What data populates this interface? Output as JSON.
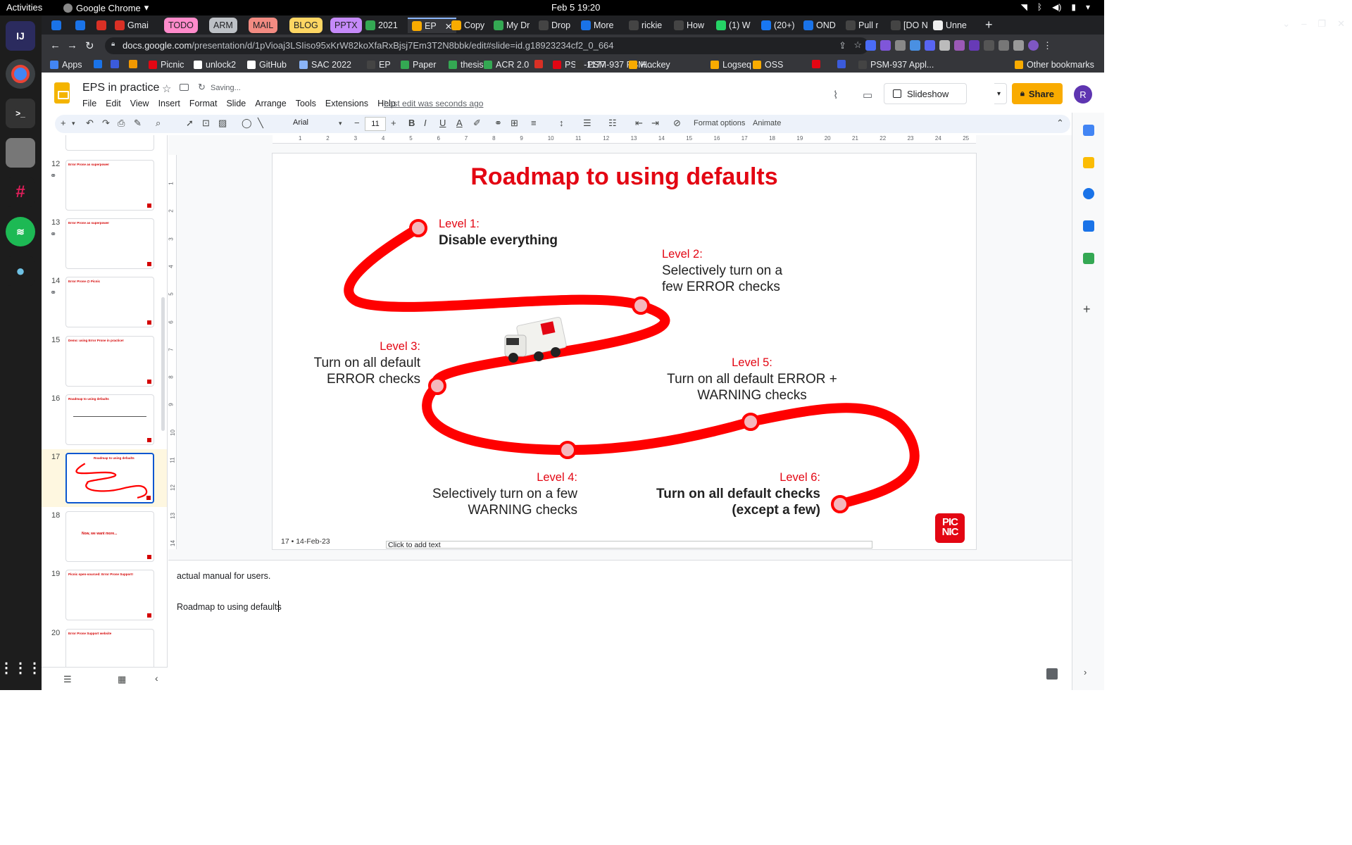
{
  "os": {
    "activities": "Activities",
    "app_menu": "Google Chrome",
    "clock": "Feb 5  19:20"
  },
  "tabs": [
    {
      "label": "",
      "color": "#1a73e8"
    },
    {
      "label": "",
      "color": "#1a73e8"
    },
    {
      "label": "",
      "color": "#d93025"
    },
    {
      "label": "Gmai",
      "color": "#d93025"
    },
    {
      "label": "TODO",
      "group_color": "#ff8bcb"
    },
    {
      "label": "ARM",
      "group_color": "#bdc1c6"
    },
    {
      "label": "MAIL",
      "group_color": "#f28b82"
    },
    {
      "label": "BLOG",
      "group_color": "#fdd663"
    },
    {
      "label": "PPTX",
      "group_color": "#c58af9"
    },
    {
      "label": "2021",
      "color": "#34a853"
    },
    {
      "label": "EP",
      "color": "#f9ab00"
    },
    {
      "label": "Copy",
      "color": "#f9ab00"
    },
    {
      "label": "My Dr",
      "color": "#34a853"
    },
    {
      "label": "Drop",
      "color": "#444"
    },
    {
      "label": "More",
      "color": "#1a73e8"
    },
    {
      "label": "rickie",
      "color": "#444"
    },
    {
      "label": "How",
      "color": "#444"
    },
    {
      "label": "(1) W",
      "color": "#25d366"
    },
    {
      "label": "(20+)",
      "color": "#1877f2"
    },
    {
      "label": "OND",
      "color": "#1a73e8"
    },
    {
      "label": "Pull r",
      "color": "#444"
    },
    {
      "label": "[DO N",
      "color": "#444"
    },
    {
      "label": "Unne",
      "color": "#eee"
    }
  ],
  "url": {
    "host": "docs.google.com",
    "path": "/presentation/d/1pVioaj3LSIiso95xKrW82koXfaRxBjsj7Em3T2N8bbk/edit#slide=id.g18923234cf2_0_664"
  },
  "bookmarks": [
    "Apps",
    "",
    "",
    "",
    "Picnic",
    "unlock2",
    "GitHub",
    "SAC 2022",
    "EP",
    "Paper",
    "thesis",
    "ACR 2.0",
    "",
    "PSM-1177",
    "PSM-937 PSM...",
    "Hockey",
    "Logseq",
    "OSS",
    "",
    "",
    "PSM-937 Appl...",
    "Other bookmarks"
  ],
  "doc": {
    "title": "EPS in practice",
    "saving": "Saving...",
    "menus": [
      "File",
      "Edit",
      "View",
      "Insert",
      "Format",
      "Slide",
      "Arrange",
      "Tools",
      "Extensions",
      "Help"
    ],
    "last_edit": "Last edit was seconds ago",
    "slideshow": "Slideshow",
    "share": "Share",
    "avatar": "R"
  },
  "toolbar": {
    "font": "Arial",
    "font_size": "11",
    "format_options": "Format options",
    "animate": "Animate"
  },
  "ruler_h": [
    "1",
    "2",
    "3",
    "4",
    "5",
    "6",
    "7",
    "8",
    "9",
    "10",
    "11",
    "12",
    "13",
    "14",
    "15",
    "16",
    "17",
    "18",
    "19",
    "20",
    "21",
    "22",
    "23",
    "24",
    "25"
  ],
  "ruler_v": [
    "1",
    "2",
    "3",
    "4",
    "5",
    "6",
    "7",
    "8",
    "9",
    "10",
    "11",
    "12",
    "13",
    "14"
  ],
  "filmstrip": [
    {
      "num": "12",
      "title": "Error Prone as superpower"
    },
    {
      "num": "13",
      "title": "Error Prone as superpower"
    },
    {
      "num": "14",
      "title": "Error Prone @ Picnic"
    },
    {
      "num": "15",
      "title": "Demo: using Error Prone in practice!"
    },
    {
      "num": "16",
      "title": "Roadmap to using defaults"
    },
    {
      "num": "17",
      "title": "Roadmap to using defaults"
    },
    {
      "num": "18",
      "title": "Now, we want more..."
    },
    {
      "num": "19",
      "title": "Picnic open-sourced: Error Prone Support!"
    },
    {
      "num": "20",
      "title": "Error Prone Support website"
    }
  ],
  "slide": {
    "title": "Roadmap to using defaults",
    "levels": [
      {
        "key": "Level 1:",
        "text": "Disable everything"
      },
      {
        "key": "Level 2:",
        "text": "Selectively turn on a few ERROR checks"
      },
      {
        "key": "Level 3:",
        "text": "Turn on all default ERROR checks"
      },
      {
        "key": "Level 4:",
        "text": "Selectively turn on a few WARNING checks"
      },
      {
        "key": "Level 5:",
        "text": "Turn on all default ERROR + WARNING checks"
      },
      {
        "key": "Level 6:",
        "text": "Turn on all default checks (except a few)"
      }
    ],
    "footer": "17 • 14-Feb-23",
    "logo_text": "PIC NIC",
    "accent": "#e30613"
  },
  "notes": {
    "placeholder": "Click to add text",
    "lines": [
      "actual manual for users.",
      "Roadmap to using defaults"
    ]
  }
}
